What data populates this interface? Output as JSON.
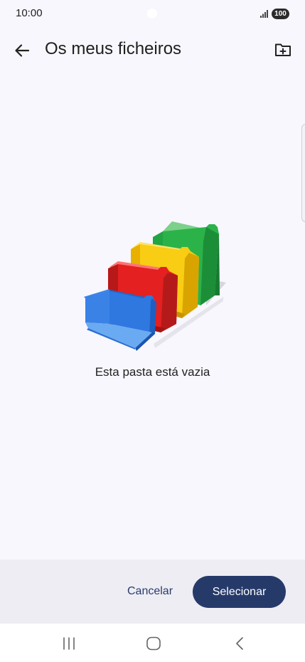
{
  "status_bar": {
    "time": "10:00",
    "battery": "100",
    "icons": [
      "signal-icon",
      "battery-icon"
    ]
  },
  "header": {
    "title": "Os meus ficheiros",
    "back_icon": "arrow-left-icon",
    "new_folder_icon": "new-folder-icon"
  },
  "empty_state": {
    "message": "Esta pasta está vazia",
    "illustration_icon": "empty-folders-illustration",
    "folder_colors": [
      "#2f78e0",
      "#dd2222",
      "#f5c518",
      "#22a244"
    ]
  },
  "actions": {
    "cancel_label": "Cancelar",
    "select_label": "Selecionar",
    "accent_color": "#263a6a"
  },
  "nav_bar": {
    "icons": [
      "recents-icon",
      "home-icon",
      "back-icon"
    ]
  }
}
